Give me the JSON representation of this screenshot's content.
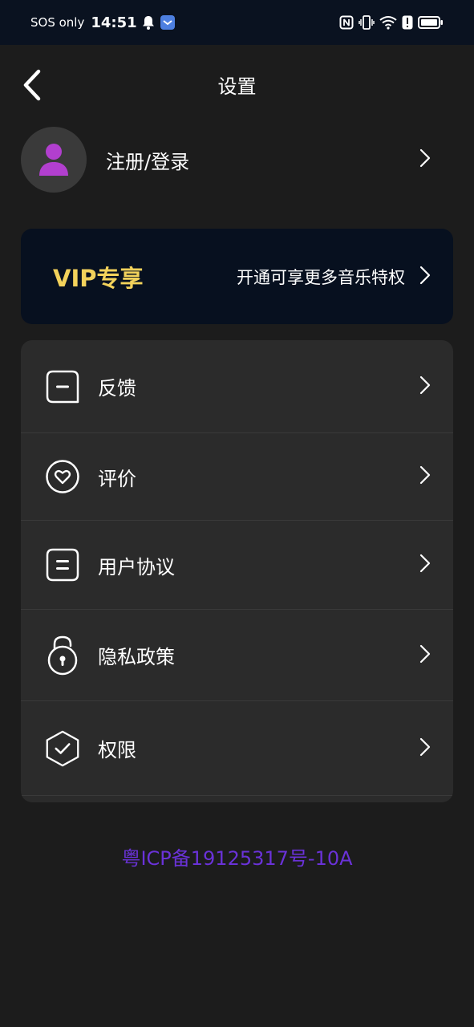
{
  "status_bar": {
    "sos": "SOS only",
    "time": "14:51"
  },
  "header": {
    "title": "设置"
  },
  "login": {
    "label": "注册/登录"
  },
  "vip": {
    "title": "VIP专享",
    "description": "开通可享更多音乐特权"
  },
  "menu": {
    "items": [
      {
        "label": "反馈",
        "icon": "feedback-icon"
      },
      {
        "label": "评价",
        "icon": "heart-icon"
      },
      {
        "label": "用户协议",
        "icon": "document-icon"
      },
      {
        "label": "隐私政策",
        "icon": "lock-icon"
      },
      {
        "label": "权限",
        "icon": "shield-check-icon"
      }
    ]
  },
  "footer": {
    "icp": "粤ICP备19125317号-10A"
  },
  "colors": {
    "background": "#1c1c1c",
    "status_bar": "#0a1220",
    "vip_gold": "#f3d25b",
    "avatar_purple": "#b23fcf",
    "icp_purple": "#6a32d8",
    "card": "#2b2b2b"
  }
}
